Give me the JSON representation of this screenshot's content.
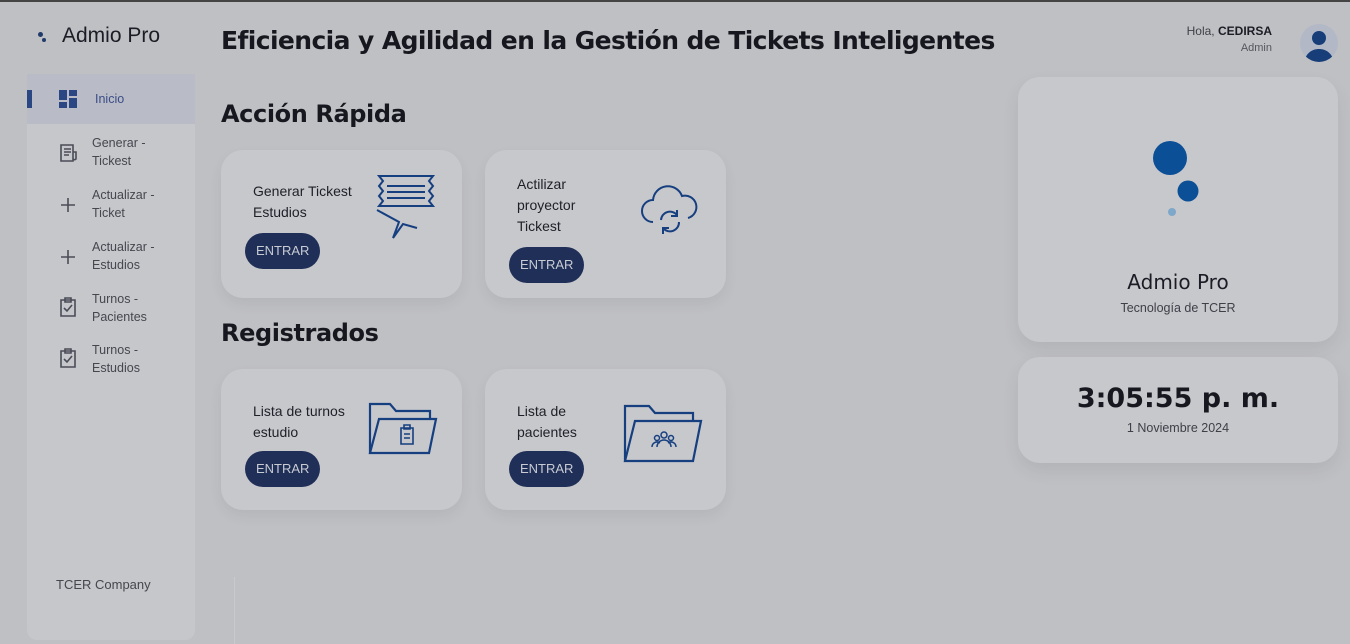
{
  "app": {
    "name": "Admio Pro"
  },
  "sidebar": {
    "items": [
      {
        "label": "Inicio",
        "icon": "dashboard-icon",
        "active": true
      },
      {
        "label": "Generar - Tickest",
        "icon": "receipt-icon"
      },
      {
        "label": "Actualizar - Ticket",
        "icon": "plus-icon"
      },
      {
        "label": "Actualizar - Estudios",
        "icon": "plus-icon"
      },
      {
        "label": "Turnos - Pacientes",
        "icon": "clipboard-check-icon"
      },
      {
        "label": "Turnos - Estudios",
        "icon": "clipboard-check-icon"
      }
    ],
    "footer": "TCER Company"
  },
  "header": {
    "title": "Eficiencia y Agilidad en la Gestión de Tickets Inteligentes",
    "greeting": "Hola,",
    "user_name": "CEDIRSA",
    "role": "Admin"
  },
  "quick_action": {
    "title": "Acción Rápida",
    "cards": [
      {
        "label": "Generar Tickest Estudios",
        "button": "ENTRAR",
        "icon": "tickets-icon"
      },
      {
        "label": "Actilizar proyector Tickest",
        "button": "ENTRAR",
        "icon": "cloud-sync-icon"
      }
    ]
  },
  "registered": {
    "title": "Registrados",
    "cards": [
      {
        "label": "Lista de turnos estudio",
        "button": "ENTRAR",
        "icon": "folder-clipboard-icon"
      },
      {
        "label": "Lista de pacientes",
        "button": "ENTRAR",
        "icon": "folder-users-icon"
      }
    ]
  },
  "brand_panel": {
    "title": "Admio Pro",
    "subtitle": "Tecnología de TCER"
  },
  "clock_panel": {
    "time": "3:05:55 p. m.",
    "date": "1 Noviembre 2024"
  },
  "colors": {
    "accent": "#1f2f58",
    "logo_primary": "#0b4f97",
    "background": "#bfc0c4"
  }
}
